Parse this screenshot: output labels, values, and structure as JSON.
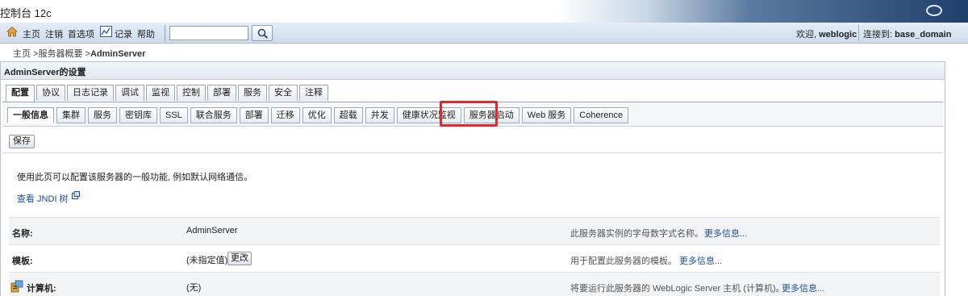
{
  "window": {
    "title": "控制台 12c"
  },
  "toolbar": {
    "home": "主页",
    "logout": "注销",
    "preferences": "首选项",
    "record": "记录",
    "help": "帮助",
    "search_value": "",
    "welcome_prefix": "欢迎,",
    "user": "weblogic",
    "connected_prefix": "连接到:",
    "domain": "base_domain"
  },
  "breadcrumb": {
    "home": "主页",
    "sep1": " >",
    "servers": "服务器概要",
    "sep2": " >",
    "current": "AdminServer"
  },
  "panel": {
    "title": "AdminServer的设置"
  },
  "tabs_primary": [
    "配置",
    "协议",
    "日志记录",
    "调试",
    "监视",
    "控制",
    "部署",
    "服务",
    "安全",
    "注释"
  ],
  "tabs_secondary": [
    "一般信息",
    "集群",
    "服务",
    "密钥库",
    "SSL",
    "联合服务",
    "部署",
    "迁移",
    "优化",
    "超载",
    "并发",
    "健康状况监视",
    "服务器启动",
    "Web 服务",
    "Coherence"
  ],
  "actions": {
    "save": "保存",
    "change": "更改"
  },
  "description": "使用此页可以配置该服务器的一般功能, 例如默认网络通信。",
  "jndi_link": "查看 JNDI 树",
  "rows": [
    {
      "label": "名称:",
      "value": "AdminServer",
      "help": "此服务器实例的字母数字式名称。",
      "more": "更多信息..."
    },
    {
      "label": "模板:",
      "value": "(未指定值)",
      "help": "用于配置此服务器的模板。",
      "more": "更多信息..."
    },
    {
      "label": "计算机:",
      "value": "(无)",
      "help": "将要运行此服务器的 WebLogic Server 主机 (计算机)。",
      "more": "更多信息..."
    }
  ],
  "colors": {
    "highlight": "#e0292e",
    "link": "#1f4f9a",
    "toolbar": "#d6e2f0"
  },
  "icons": [
    "home-icon",
    "chart-icon",
    "search-icon",
    "external-link-icon",
    "machine-icon",
    "oracle-logo"
  ]
}
